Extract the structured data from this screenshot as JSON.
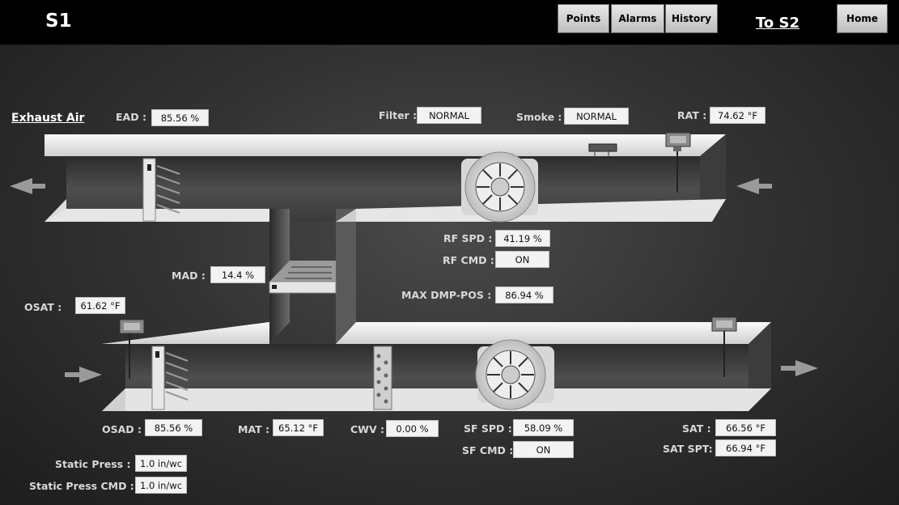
{
  "header": {
    "title": "S1",
    "buttons": {
      "points": "Points",
      "alarms": "Alarms",
      "history": "History",
      "home": "Home"
    },
    "link_s2": "To S2"
  },
  "labels": {
    "exhaust_air": "Exhaust Air",
    "ead": "EAD :",
    "filter": "Filter :",
    "smoke": "Smoke :",
    "rat": "RAT :",
    "rf_spd": "RF SPD :",
    "rf_cmd": "RF CMD :",
    "mad": "MAD :",
    "max_dmp": "MAX DMP-POS :",
    "osat": "OSAT :",
    "osad": "OSAD :",
    "mat": "MAT :",
    "cwv": "CWV :",
    "sf_spd": "SF SPD :",
    "sf_cmd": "SF CMD :",
    "sat": "SAT :",
    "sat_spt": "SAT SPT:",
    "static_press": "Static Press :",
    "static_press_cmd": "Static Press CMD :"
  },
  "values": {
    "ead": "85.56 %",
    "filter": "NORMAL",
    "smoke": "NORMAL",
    "rat": "74.62 °F",
    "rf_spd": "41.19 %",
    "rf_cmd": "ON",
    "mad": "14.4 %",
    "max_dmp": "86.94 %",
    "osat": "61.62 °F",
    "osad": "85.56 %",
    "mat": "65.12 °F",
    "cwv": "0.00 %",
    "sf_spd": "58.09 %",
    "sf_cmd": "ON",
    "sat": "66.56 °F",
    "sat_spt": "66.94 °F",
    "static_press": "1.0 in/wc",
    "static_press_cmd": "1.0 in/wc"
  },
  "colors": {
    "header_bg": "#000000",
    "button_bg": "#d6d6d6",
    "value_bg": "#f3f3f3"
  }
}
